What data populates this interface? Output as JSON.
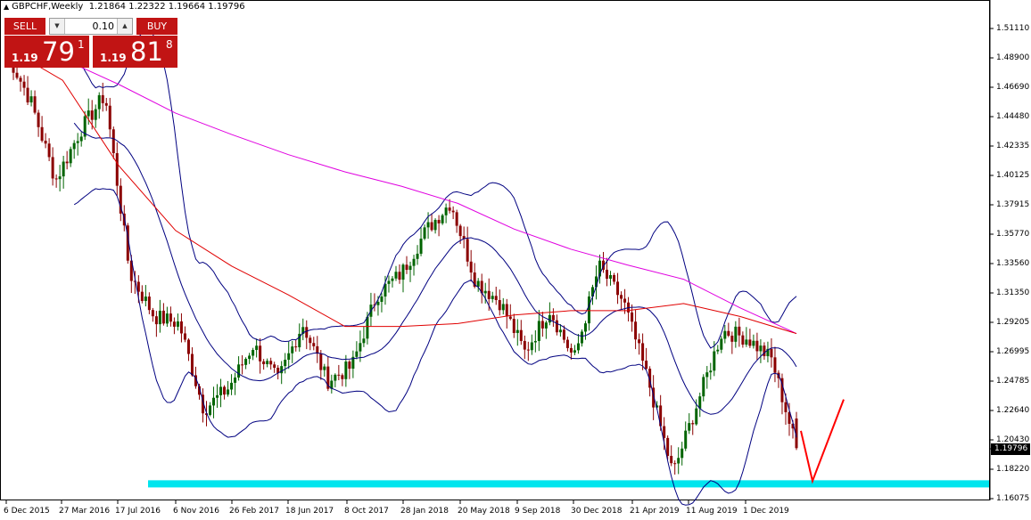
{
  "header": {
    "symbol_timeframe": "GBPCHF,Weekly",
    "ohlc": "1.21864 1.22322 1.19664 1.19796"
  },
  "trade_panel": {
    "sell_label": "SELL",
    "buy_label": "BUY",
    "lot_value": "0.10",
    "bid": {
      "small": "1.19",
      "big": "79",
      "sup": "1"
    },
    "ask": {
      "small": "1.19",
      "big": "81",
      "sup": "8"
    }
  },
  "colors": {
    "candle_up": "#006400",
    "candle_down": "#8b0000",
    "bollinger": "#000080",
    "ma_slow": "#e000e0",
    "ma_fast": "#e00000",
    "support_zone": "#00e5ee",
    "projection": "#ff0000",
    "trade_red": "#c11414"
  },
  "axis": {
    "current_price": "1.19796",
    "y_ticks": [
      "1.51110",
      "1.48900",
      "1.46690",
      "1.44480",
      "1.42335",
      "1.40125",
      "1.37915",
      "1.35770",
      "1.33560",
      "1.31350",
      "1.29205",
      "1.26995",
      "1.24785",
      "1.22640",
      "1.20430",
      "1.18220",
      "1.16075"
    ],
    "x_ticks": [
      "6 Dec 2015",
      "27 Mar 2016",
      "17 Jul 2016",
      "6 Nov 2016",
      "26 Feb 2017",
      "18 Jun 2017",
      "8 Oct 2017",
      "28 Jan 2018",
      "20 May 2018",
      "9 Sep 2018",
      "30 Dec 2018",
      "21 Apr 2019",
      "11 Aug 2019",
      "1 Dec 2019"
    ]
  },
  "chart_data": {
    "type": "candlestick",
    "symbol": "GBPCHF",
    "timeframe": "Weekly",
    "ylim": [
      1.1608,
      1.5111
    ],
    "support_zone": [
      1.1705,
      1.1755
    ],
    "series": [
      {
        "name": "close_path",
        "points": [
          [
            "6 Dec 2015",
            1.475
          ],
          [
            "Jan 2016",
            1.44
          ],
          [
            "Feb 2016",
            1.385
          ],
          [
            "27 Mar 2016",
            1.42
          ],
          [
            "May 2016",
            1.445
          ],
          [
            "Jun 2016",
            1.32
          ],
          [
            "17 Jul 2016",
            1.29
          ],
          [
            "Aug 2016",
            1.285
          ],
          [
            "Oct 2016",
            1.225
          ],
          [
            "6 Nov 2016",
            1.24
          ],
          [
            "Dec 2016",
            1.27
          ],
          [
            "26 Feb 2017",
            1.245
          ],
          [
            "Apr 2017",
            1.285
          ],
          [
            "18 Jun 2017",
            1.245
          ],
          [
            "Aug 2017",
            1.255
          ],
          [
            "8 Oct 2017",
            1.305
          ],
          [
            "Dec 2017",
            1.32
          ],
          [
            "28 Jan 2018",
            1.35
          ],
          [
            "Mar 2018",
            1.37
          ],
          [
            "20 May 2018",
            1.315
          ],
          [
            "Jul 2018",
            1.3
          ],
          [
            "9 Sep 2018",
            1.265
          ],
          [
            "Nov 2018",
            1.295
          ],
          [
            "30 Dec 2018",
            1.26
          ],
          [
            "Feb 2019",
            1.325
          ],
          [
            "21 Apr 2019",
            1.3
          ],
          [
            "Jun 2019",
            1.245
          ],
          [
            "11 Aug 2019",
            1.18
          ],
          [
            "Oct 2019",
            1.23
          ],
          [
            "1 Dec 2019",
            1.28
          ],
          [
            "Jan 2020",
            1.275
          ],
          [
            "Feb 2020",
            1.26
          ],
          [
            "Mar 2020",
            1.198
          ]
        ]
      },
      {
        "name": "ma_slow",
        "values": [
          1.481,
          1.47,
          1.452,
          1.432,
          1.417,
          1.403,
          1.391,
          1.381,
          1.369,
          1.351,
          1.337,
          1.326,
          1.316,
          1.296,
          1.278
        ]
      },
      {
        "name": "ma_fast",
        "values": [
          1.478,
          1.455,
          1.395,
          1.35,
          1.325,
          1.305,
          1.283,
          1.283,
          1.285,
          1.291,
          1.294,
          1.294,
          1.299,
          1.29,
          1.278
        ]
      }
    ],
    "projection": [
      [
        1.21,
        1.175
      ],
      [
        1.175,
        1.232
      ]
    ]
  }
}
